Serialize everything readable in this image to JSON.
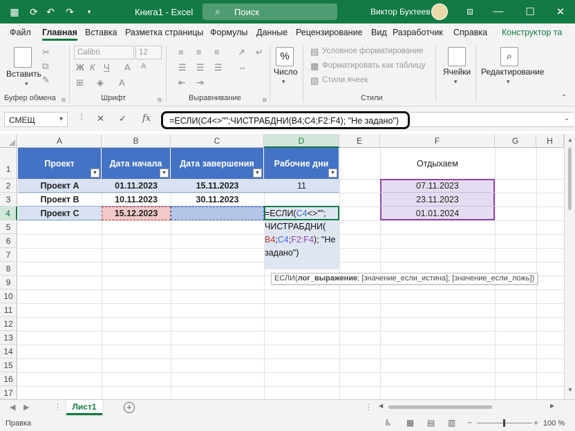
{
  "titlebar": {
    "doc_title": "Книга1 - Excel",
    "search_placeholder": "Поиск",
    "user_name": "Виктор Бухтеев",
    "minimize": "—",
    "restore": "☐",
    "close": "✕"
  },
  "ribbon_tabs": [
    "Файл",
    "Главная",
    "Вставка",
    "Разметка страницы",
    "Формулы",
    "Данные",
    "Рецензирование",
    "Вид",
    "Разработчик",
    "Справка",
    "Конструктор та"
  ],
  "ribbon": {
    "paste_label": "Вставить",
    "clipboard_group": "Буфер обмена",
    "font_name": "Calibri",
    "font_size": "12",
    "font_group": "Шрифт",
    "alignment_group": "Выравнивание",
    "number_label": "Число",
    "conditional_format": "Условное форматирование",
    "format_as_table": "Форматировать как таблицу",
    "cell_styles": "Стили ячеек",
    "styles_group": "Стили",
    "cells_label": "Ячейки",
    "editing_label": "Редактирование",
    "percent_symbol": "%"
  },
  "formula_bar": {
    "name_box": "СМЕЩ",
    "fx": "fx",
    "formula": "=ЕСЛИ(C4<>\"\";ЧИСТРАБДНИ(B4;C4;F2:F4); \"Не задано\")"
  },
  "columns": [
    "A",
    "B",
    "C",
    "D",
    "E",
    "F",
    "G",
    "H"
  ],
  "rows": [
    "1",
    "2",
    "3",
    "4",
    "5",
    "6",
    "7",
    "8",
    "9",
    "10",
    "11",
    "12",
    "13",
    "14",
    "15",
    "16",
    "17"
  ],
  "table": {
    "headers": [
      "Проект",
      "Дата начала",
      "Дата завершения",
      "Рабочие дни"
    ],
    "rows": [
      [
        "Проект А",
        "01.11.2023",
        "15.11.2023",
        "11"
      ],
      [
        "Проект B",
        "10.11.2023",
        "30.11.2023",
        ""
      ],
      [
        "Проект C",
        "15.12.2023",
        "",
        ""
      ]
    ]
  },
  "holidays": {
    "header": "Отдыхаем",
    "dates": [
      "07.11.2023",
      "23.11.2023",
      "01.01.2024"
    ]
  },
  "in_cell_edit": {
    "line1_a": "=ЕСЛИ(",
    "line1_ref": "C4",
    "line1_b": "<>\"\";",
    "line2": "ЧИСТРАБДНИ(",
    "line3_ref1": "B4",
    "line3_sep1": ";",
    "line3_ref2": "C4",
    "line3_sep2": ";",
    "line3_ref3": "F2:F4",
    "line3_tail": "); \"Не",
    "line4": "задано\")"
  },
  "tooltip": {
    "func": "ЕСЛИ(",
    "arg1": "лог_выражение",
    "rest": "; [значение_если_истина]; [значение_если_ложь])"
  },
  "sheets": {
    "active": "Лист1",
    "add": "+"
  },
  "status": {
    "mode": "Правка",
    "zoom": "100 %"
  },
  "colors": {
    "excel_green": "#137a43",
    "table_header": "#4472c4",
    "table_band": "#d9e1f2"
  }
}
